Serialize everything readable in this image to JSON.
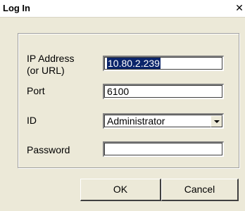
{
  "window": {
    "title": "Log In",
    "close_glyph": "✕"
  },
  "form": {
    "ip_label_line1": "IP Address",
    "ip_label_line2": "(or URL)",
    "ip_value": "10.80.2.239",
    "port_label": "Port",
    "port_value": "6100",
    "id_label": "ID",
    "id_value": "Administrator",
    "password_label": "Password",
    "password_value": ""
  },
  "buttons": {
    "ok": "OK",
    "cancel": "Cancel"
  },
  "icons": {
    "close": "close-icon",
    "dropdown": "chevron-down-icon"
  }
}
